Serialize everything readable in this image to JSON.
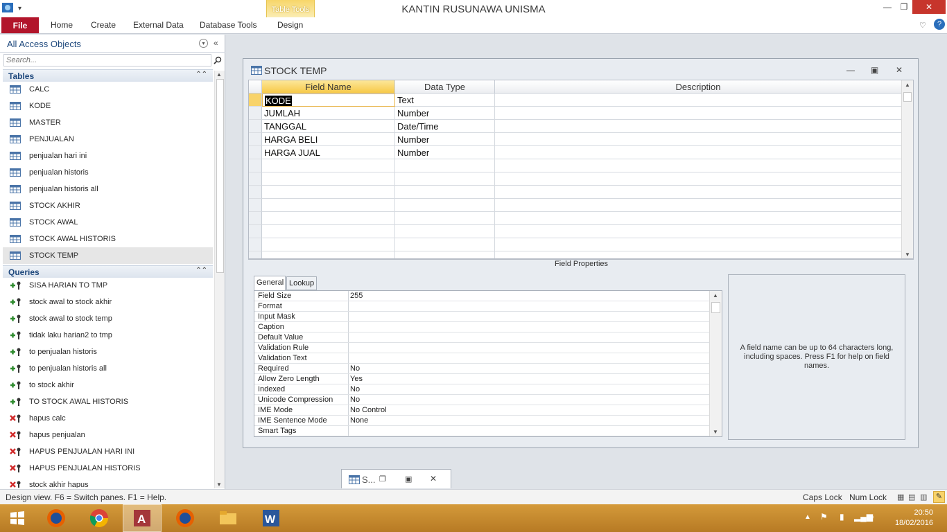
{
  "app": {
    "title": "KANTIN RUSUNAWA UNISMA",
    "context_tab_group": "Table Tools"
  },
  "ribbon": {
    "file": "File",
    "tabs": [
      "Home",
      "Create",
      "External Data",
      "Database Tools",
      "Design"
    ]
  },
  "nav": {
    "title": "All Access Objects",
    "search_placeholder": "Search...",
    "tables_header": "Tables",
    "queries_header": "Queries",
    "tables": [
      "CALC",
      "KODE",
      "MASTER",
      "PENJUALAN",
      "penjualan hari ini",
      "penjualan historis",
      "penjualan historis all",
      "STOCK AKHIR",
      "STOCK AWAL",
      "STOCK AWAL HISTORIS",
      "STOCK TEMP"
    ],
    "selected_table": "STOCK TEMP",
    "queries": [
      {
        "name": "SISA HARIAN TO TMP",
        "kind": "append"
      },
      {
        "name": "stock awal to stock akhir",
        "kind": "append"
      },
      {
        "name": "stock awal to stock temp",
        "kind": "append"
      },
      {
        "name": "tidak laku harian2 to tmp",
        "kind": "append"
      },
      {
        "name": "to penjualan historis",
        "kind": "append"
      },
      {
        "name": "to penjualan historis all",
        "kind": "append"
      },
      {
        "name": "to stock akhir",
        "kind": "append"
      },
      {
        "name": "TO STOCK AWAL HISTORIS",
        "kind": "append"
      },
      {
        "name": "hapus calc",
        "kind": "delete"
      },
      {
        "name": "hapus penjualan",
        "kind": "delete"
      },
      {
        "name": "HAPUS PENJUALAN HARI INI",
        "kind": "delete"
      },
      {
        "name": "HAPUS PENJUALAN HISTORIS",
        "kind": "delete"
      },
      {
        "name": "stock akhir hapus",
        "kind": "delete"
      }
    ]
  },
  "design_window": {
    "title": "STOCK TEMP",
    "columns": {
      "field_name": "Field Name",
      "data_type": "Data Type",
      "description": "Description"
    },
    "fields": [
      {
        "name": "KODE",
        "type": "Text"
      },
      {
        "name": "JUMLAH",
        "type": "Number"
      },
      {
        "name": "TANGGAL",
        "type": "Date/Time"
      },
      {
        "name": "HARGA BELI",
        "type": "Number"
      },
      {
        "name": "HARGA JUAL",
        "type": "Number"
      }
    ],
    "field_properties_label": "Field Properties",
    "prop_tabs": [
      "General",
      "Lookup"
    ],
    "properties": [
      {
        "name": "Field Size",
        "value": "255"
      },
      {
        "name": "Format",
        "value": ""
      },
      {
        "name": "Input Mask",
        "value": ""
      },
      {
        "name": "Caption",
        "value": ""
      },
      {
        "name": "Default Value",
        "value": ""
      },
      {
        "name": "Validation Rule",
        "value": ""
      },
      {
        "name": "Validation Text",
        "value": ""
      },
      {
        "name": "Required",
        "value": "No"
      },
      {
        "name": "Allow Zero Length",
        "value": "Yes"
      },
      {
        "name": "Indexed",
        "value": "No"
      },
      {
        "name": "Unicode Compression",
        "value": "No"
      },
      {
        "name": "IME Mode",
        "value": "No Control"
      },
      {
        "name": "IME Sentence Mode",
        "value": "None"
      },
      {
        "name": "Smart Tags",
        "value": ""
      }
    ],
    "help_text": "A field name can be up to 64 characters long, including spaces. Press F1 for help on field names."
  },
  "minimized_window": {
    "title": "S..."
  },
  "status": {
    "left": "Design view.  F6 = Switch panes.  F1 = Help.",
    "caps": "Caps Lock",
    "num": "Num Lock"
  },
  "taskbar": {
    "time": "20:50",
    "date": "18/02/2016"
  }
}
